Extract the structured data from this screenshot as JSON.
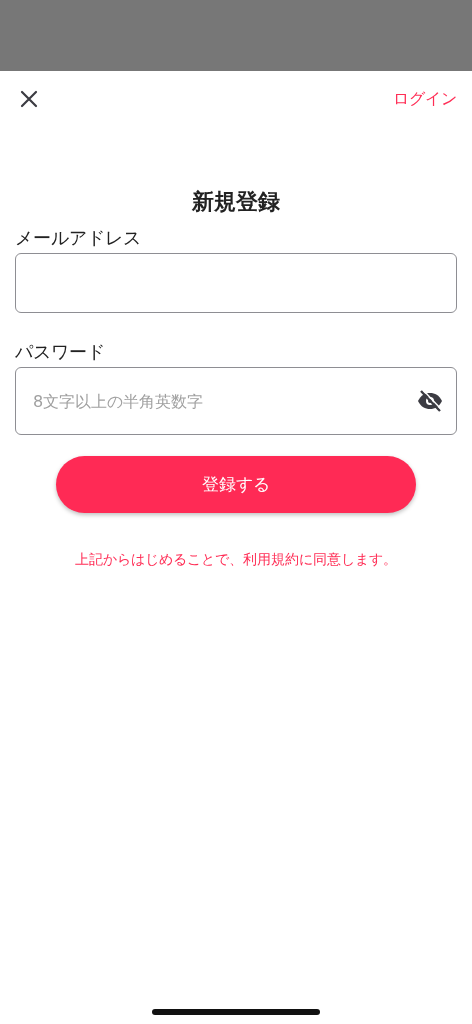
{
  "nav": {
    "login": "ログイン"
  },
  "title": "新規登録",
  "fields": [
    {
      "label": "メールアドレス",
      "kind": "email"
    },
    {
      "label": "パスワード",
      "placeholder": "8文字以上の半角英数字",
      "kind": "password",
      "visible": false
    }
  ],
  "submit": "登録する",
  "terms": "上記からはじめることで、利用規約に同意します。"
}
